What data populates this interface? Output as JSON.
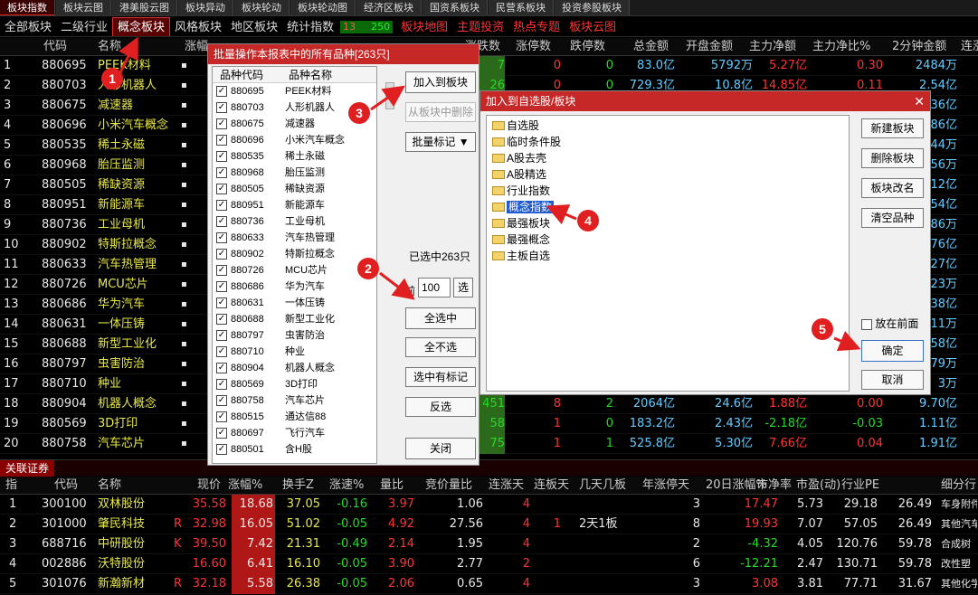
{
  "top_tabs": [
    "板块指数",
    "板块云图",
    "港美股云图",
    "板块异动",
    "板块轮动",
    "板块轮动图",
    "经济区板块",
    "国资系板块",
    "民营系板块",
    "投资参股板块"
  ],
  "category_tabs": [
    {
      "label": "全部板块",
      "style": ""
    },
    {
      "label": "二级行业",
      "style": ""
    },
    {
      "label": "概念板块",
      "style": "active"
    },
    {
      "label": "风格板块",
      "style": ""
    },
    {
      "label": "地区板块",
      "style": ""
    },
    {
      "label": "统计指数",
      "style": ""
    }
  ],
  "mini_bar": {
    "left": "13",
    "right": "250"
  },
  "category_extra": [
    {
      "label": "板块地图",
      "style": "red"
    },
    {
      "label": "主题投资",
      "style": "red"
    },
    {
      "label": "热点专题",
      "style": "red"
    },
    {
      "label": "板块云图",
      "style": "red"
    }
  ],
  "main_headers": [
    "代码",
    "名称",
    "涨幅",
    "涨跌数",
    "涨停数",
    "跌停数",
    "总金额",
    "开盘金额",
    "主力净额",
    "主力净比%",
    "2分钟金额",
    "连涨"
  ],
  "main_rows": [
    {
      "n": "1",
      "code": "880695",
      "name": "PEEK材料",
      "zd": "7",
      "zt": "0",
      "dt": "0",
      "amt": "83.0亿",
      "open": "5792万",
      "net": "5.27亿",
      "ratio": "0.30",
      "m2": "2484万"
    },
    {
      "n": "2",
      "code": "880703",
      "name": "人形机器人",
      "zd": "26",
      "zt": "0",
      "dt": "0",
      "amt": "729.3亿",
      "open": "10.8亿",
      "net": "14.85亿",
      "ratio": "0.11",
      "m2": "2.54亿"
    },
    {
      "n": "3",
      "code": "880675",
      "name": "减速器",
      "zd": "",
      "zt": "",
      "dt": "",
      "amt": "",
      "open": "",
      "net": "",
      "ratio": "",
      "m2": "36亿"
    },
    {
      "n": "4",
      "code": "880696",
      "name": "小米汽车概念",
      "zd": "",
      "zt": "",
      "dt": "",
      "amt": "",
      "open": "",
      "net": "",
      "ratio": "",
      "m2": "86亿"
    },
    {
      "n": "5",
      "code": "880535",
      "name": "稀土永磁",
      "zd": "",
      "zt": "",
      "dt": "",
      "amt": "",
      "open": "",
      "net": "",
      "ratio": "",
      "m2": "44万"
    },
    {
      "n": "6",
      "code": "880968",
      "name": "胎压监测",
      "zd": "",
      "zt": "",
      "dt": "",
      "amt": "",
      "open": "",
      "net": "",
      "ratio": "",
      "m2": "56万"
    },
    {
      "n": "7",
      "code": "880505",
      "name": "稀缺资源",
      "zd": "",
      "zt": "",
      "dt": "",
      "amt": "",
      "open": "",
      "net": "",
      "ratio": "",
      "m2": "12亿"
    },
    {
      "n": "8",
      "code": "880951",
      "name": "新能源车",
      "zd": "",
      "zt": "",
      "dt": "",
      "amt": "",
      "open": "",
      "net": "",
      "ratio": "",
      "m2": "54亿"
    },
    {
      "n": "9",
      "code": "880736",
      "name": "工业母机",
      "zd": "",
      "zt": "",
      "dt": "",
      "amt": "",
      "open": "",
      "net": "",
      "ratio": "",
      "m2": "86万"
    },
    {
      "n": "10",
      "code": "880902",
      "name": "特斯拉概念",
      "zd": "",
      "zt": "",
      "dt": "",
      "amt": "",
      "open": "",
      "net": "",
      "ratio": "",
      "m2": "76亿"
    },
    {
      "n": "11",
      "code": "880633",
      "name": "汽车热管理",
      "zd": "",
      "zt": "",
      "dt": "",
      "amt": "",
      "open": "",
      "net": "",
      "ratio": "",
      "m2": "27亿"
    },
    {
      "n": "12",
      "code": "880726",
      "name": "MCU芯片",
      "zd": "",
      "zt": "",
      "dt": "",
      "amt": "",
      "open": "",
      "net": "",
      "ratio": "",
      "m2": "23万"
    },
    {
      "n": "13",
      "code": "880686",
      "name": "华为汽车",
      "zd": "",
      "zt": "",
      "dt": "",
      "amt": "",
      "open": "",
      "net": "",
      "ratio": "",
      "m2": "38亿"
    },
    {
      "n": "14",
      "code": "880631",
      "name": "一体压铸",
      "zd": "",
      "zt": "",
      "dt": "",
      "amt": "",
      "open": "",
      "net": "",
      "ratio": "",
      "m2": "11万"
    },
    {
      "n": "15",
      "code": "880688",
      "name": "新型工业化",
      "zd": "",
      "zt": "",
      "dt": "",
      "amt": "",
      "open": "",
      "net": "",
      "ratio": "",
      "m2": "58亿"
    },
    {
      "n": "16",
      "code": "880797",
      "name": "虫害防治",
      "zd": "",
      "zt": "",
      "dt": "",
      "amt": "",
      "open": "",
      "net": "",
      "ratio": "",
      "m2": "79万"
    },
    {
      "n": "17",
      "code": "880710",
      "name": "种业",
      "zd": "",
      "zt": "",
      "dt": "",
      "amt": "",
      "open": "",
      "net": "",
      "ratio": "",
      "m2": "3万"
    },
    {
      "n": "18",
      "code": "880904",
      "name": "机器人概念",
      "zd": "451",
      "zt": "8",
      "dt": "2",
      "amt": "2064亿",
      "open": "24.6亿",
      "net": "1.88亿",
      "ratio": "0.00",
      "m2": "9.70亿"
    },
    {
      "n": "19",
      "code": "880569",
      "name": "3D打印",
      "zd": "58",
      "zt": "1",
      "dt": "0",
      "amt": "183.2亿",
      "open": "2.43亿",
      "net": "-2.18亿",
      "ratio": "-0.03",
      "m2": "1.11亿"
    },
    {
      "n": "20",
      "code": "880758",
      "name": "汽车芯片",
      "zd": "75",
      "zt": "1",
      "dt": "1",
      "amt": "525.8亿",
      "open": "5.30亿",
      "net": "7.66亿",
      "ratio": "0.04",
      "m2": "1.91亿"
    }
  ],
  "lower_tab": "关联证券",
  "lower_headers": [
    "指",
    "代码",
    "名称",
    "现价",
    "涨幅%",
    "换手Z",
    "涨速%",
    "量比",
    "竞价量比",
    "连涨天",
    "连板天",
    "几天几板",
    "年涨停天",
    "20日涨幅%",
    "市净率",
    "市盈(动)",
    "行业PE",
    "细分行"
  ],
  "lower_rows": [
    {
      "n": "1",
      "code": "300100",
      "name": "双林股份",
      "flag": "",
      "price": "35.58",
      "chg": "18.68",
      "turn": "37.05",
      "speed": "-0.16",
      "vr": "3.97",
      "bid": "1.06",
      "up": "4",
      "board": "",
      "nd": "",
      "yz": "3",
      "d20": "17.47",
      "pb": "5.73",
      "pe": "29.18",
      "ipe": "26.49",
      "seg": "车身附件"
    },
    {
      "n": "2",
      "code": "301000",
      "name": "肇民科技",
      "flag": "R",
      "price": "32.98",
      "chg": "16.05",
      "turn": "51.02",
      "speed": "-0.05",
      "vr": "4.92",
      "bid": "27.56",
      "up": "4",
      "board": "1",
      "nd": "2天1板",
      "yz": "8",
      "d20": "19.93",
      "pb": "7.07",
      "pe": "57.05",
      "ipe": "26.49",
      "seg": "其他汽车"
    },
    {
      "n": "3",
      "code": "688716",
      "name": "中研股份",
      "flag": "K",
      "price": "39.50",
      "chg": "7.42",
      "turn": "21.31",
      "speed": "-0.49",
      "vr": "2.14",
      "bid": "1.95",
      "up": "4",
      "board": "",
      "nd": "",
      "yz": "2",
      "d20": "-4.32",
      "pb": "4.05",
      "pe": "120.76",
      "ipe": "59.78",
      "seg": "合成树"
    },
    {
      "n": "4",
      "code": "002886",
      "name": "沃特股份",
      "flag": "",
      "price": "16.60",
      "chg": "6.41",
      "turn": "16.10",
      "speed": "-0.05",
      "vr": "3.90",
      "bid": "2.77",
      "up": "2",
      "board": "",
      "nd": "",
      "yz": "6",
      "d20": "-12.21",
      "pb": "2.47",
      "pe": "130.71",
      "ipe": "59.78",
      "seg": "改性塑"
    },
    {
      "n": "5",
      "code": "301076",
      "name": "新瀚新材",
      "flag": "R",
      "price": "32.18",
      "chg": "5.58",
      "turn": "26.38",
      "speed": "-0.05",
      "vr": "2.06",
      "bid": "0.65",
      "up": "4",
      "board": "",
      "nd": "",
      "yz": "3",
      "d20": "3.08",
      "pb": "3.81",
      "pe": "77.71",
      "ipe": "31.67",
      "seg": "其他化学"
    }
  ],
  "batch_dialog": {
    "title": "批量操作本报表中的所有品种[263只]",
    "col_code": "品种代码",
    "col_name": "品种名称",
    "items": [
      {
        "code": "880695",
        "name": "PEEK材料"
      },
      {
        "code": "880703",
        "name": "人形机器人"
      },
      {
        "code": "880675",
        "name": "减速器"
      },
      {
        "code": "880696",
        "name": "小米汽车概念"
      },
      {
        "code": "880535",
        "name": "稀土永磁"
      },
      {
        "code": "880968",
        "name": "胎压监测"
      },
      {
        "code": "880505",
        "name": "稀缺资源"
      },
      {
        "code": "880951",
        "name": "新能源车"
      },
      {
        "code": "880736",
        "name": "工业母机"
      },
      {
        "code": "880633",
        "name": "汽车热管理"
      },
      {
        "code": "880902",
        "name": "特斯拉概念"
      },
      {
        "code": "880726",
        "name": "MCU芯片"
      },
      {
        "code": "880686",
        "name": "华为汽车"
      },
      {
        "code": "880631",
        "name": "一体压铸"
      },
      {
        "code": "880688",
        "name": "新型工业化"
      },
      {
        "code": "880797",
        "name": "虫害防治"
      },
      {
        "code": "880710",
        "name": "种业"
      },
      {
        "code": "880904",
        "name": "机器人概念"
      },
      {
        "code": "880569",
        "name": "3D打印"
      },
      {
        "code": "880758",
        "name": "汽车芯片"
      },
      {
        "code": "880515",
        "name": "通达信88"
      },
      {
        "code": "880697",
        "name": "飞行汽车"
      },
      {
        "code": "880501",
        "name": "含H股"
      }
    ],
    "add_to_block": "加入到板块",
    "remove_from_block": "从板块中删除",
    "batch_mark": "批量标记 ▼",
    "selected_count": "已选中263只",
    "front_label": "前",
    "front_value": "100",
    "select_btn": "选",
    "select_all": "全选中",
    "select_none": "全不选",
    "select_marked": "选中有标记",
    "invert": "反选",
    "close": "关闭"
  },
  "add_dialog": {
    "title": "加入到自选股/板块",
    "folders": [
      "自选股",
      "临时条件股",
      "A股去壳",
      "A股精选",
      "行业指数",
      "概念指数",
      "最强板块",
      "最强概念",
      "主板自选"
    ],
    "selected_index": 5,
    "new_block": "新建板块",
    "delete_block": "删除板块",
    "rename_block": "板块改名",
    "clear_items": "清空品种",
    "put_front": "放在前面",
    "ok": "确定",
    "cancel": "取消"
  },
  "badges": [
    "1",
    "2",
    "3",
    "4",
    "5"
  ],
  "colors": {
    "up": "#ff3333",
    "down": "#22dd22",
    "title_bar": "#c62828",
    "badge": "#e02020"
  }
}
